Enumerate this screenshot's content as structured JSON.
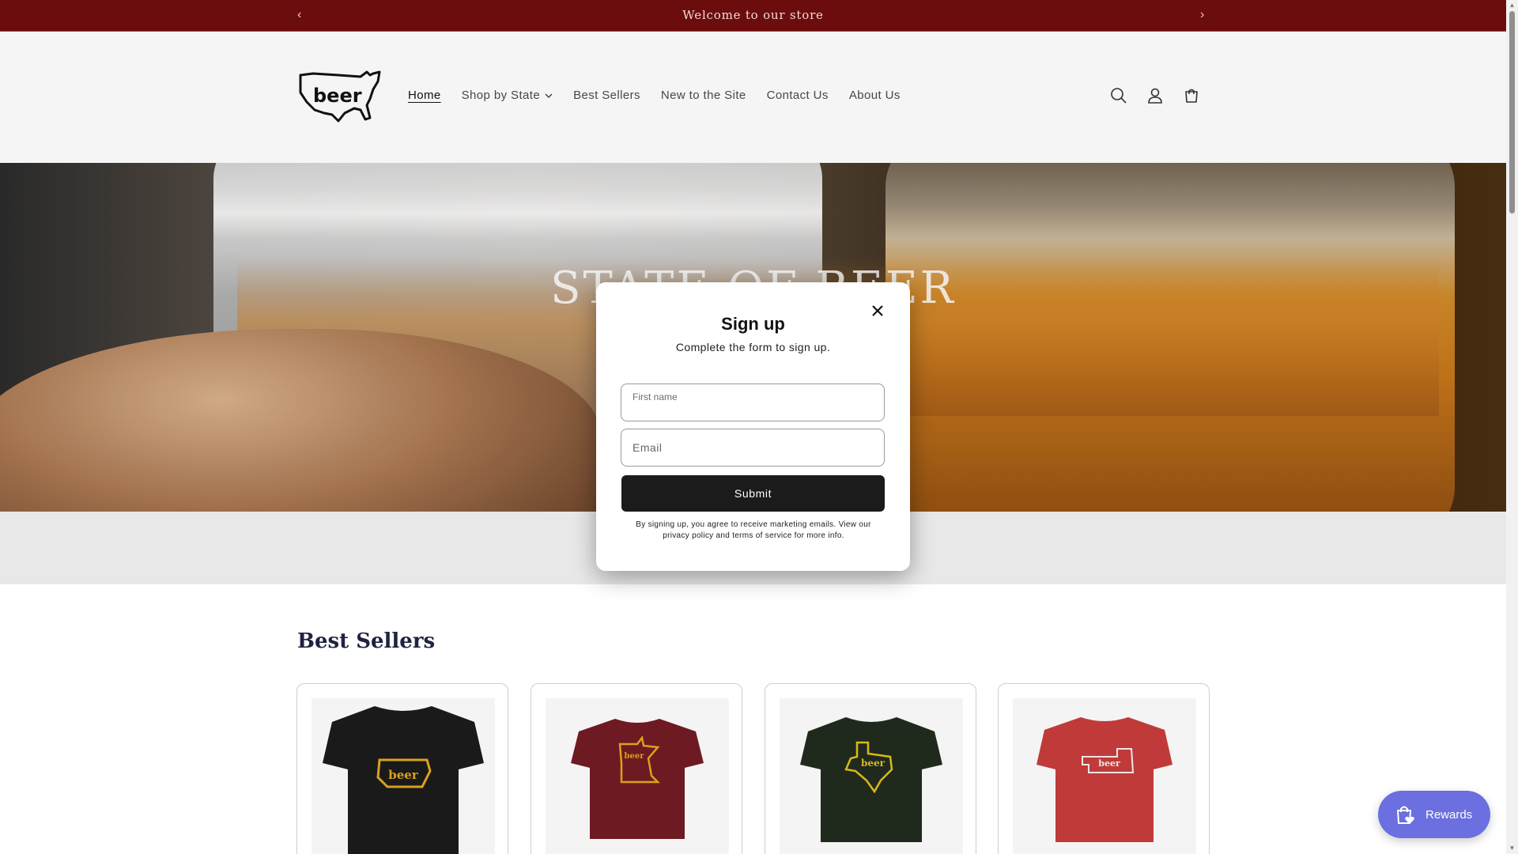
{
  "announcement": {
    "text": "Welcome to our store",
    "prev": "‹",
    "next": "›"
  },
  "header": {
    "logo_text": "beer",
    "nav": [
      {
        "label": "Home",
        "active": true
      },
      {
        "label": "Shop by State",
        "has_dropdown": true
      },
      {
        "label": "Best Sellers"
      },
      {
        "label": "New to the Site"
      },
      {
        "label": "Contact Us"
      },
      {
        "label": "About Us"
      }
    ],
    "icons": [
      "search-icon",
      "account-icon",
      "cart-icon"
    ]
  },
  "hero": {
    "title": "STATE OF BEER"
  },
  "best_sellers": {
    "title": "Best Sellers",
    "products": [
      {
        "shirt_color": "#1a1a1a",
        "print_color": "#d9a21a",
        "state": "Iowa",
        "print_text": "beer"
      },
      {
        "shirt_color": "#6e1a22",
        "print_color": "#d9a21a",
        "state": "Minnesota",
        "print_text": "beer"
      },
      {
        "shirt_color": "#1f2a1c",
        "print_color": "#d9b81a",
        "state": "Texas",
        "print_text": "beer"
      },
      {
        "shirt_color": "#c13a3a",
        "print_color": "#f0e6e6",
        "state": "Nebraska",
        "print_text": "beer"
      }
    ]
  },
  "signup_modal": {
    "title": "Sign up",
    "subtitle": "Complete the form to sign up.",
    "first_name_label": "First name",
    "email_placeholder": "Email",
    "submit_label": "Submit",
    "legal": "By signing up, you agree to receive marketing emails. View our privacy policy and terms of service for more info."
  },
  "rewards": {
    "label": "Rewards"
  },
  "colors": {
    "announcement_bg": "#6b0d0d",
    "rewards_bg": "#6b6fe0",
    "heading": "#1f2240"
  }
}
